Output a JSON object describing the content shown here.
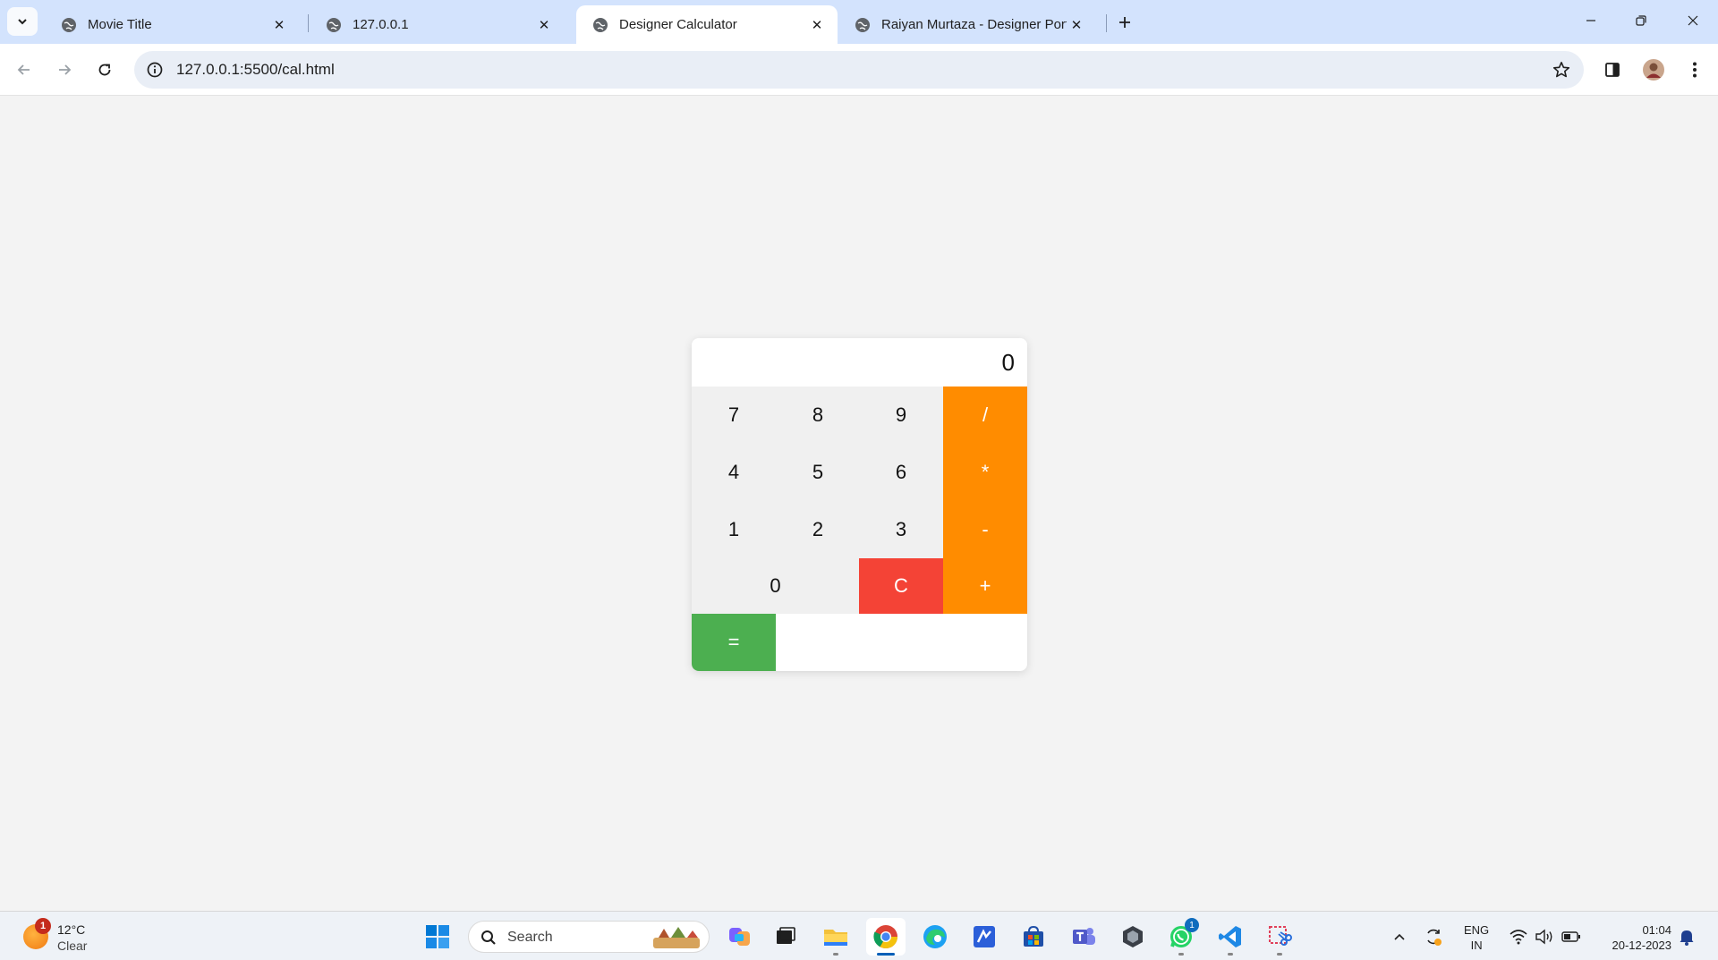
{
  "browser": {
    "tabs": [
      {
        "title": "Movie Title",
        "active": false
      },
      {
        "title": "127.0.0.1",
        "active": false
      },
      {
        "title": "Designer Calculator",
        "active": true
      },
      {
        "title": "Raiyan Murtaza - Designer Portfolio",
        "active": false
      }
    ],
    "url": "127.0.0.1:5500/cal.html"
  },
  "calculator": {
    "display": "0",
    "keys": {
      "seven": "7",
      "eight": "8",
      "nine": "9",
      "divide": "/",
      "four": "4",
      "five": "5",
      "six": "6",
      "multiply": "*",
      "one": "1",
      "two": "2",
      "three": "3",
      "subtract": "-",
      "zero": "0",
      "clear": "C",
      "add": "+",
      "equals": "="
    },
    "colors": {
      "operator": "#ff8c00",
      "clear": "#f44336",
      "equals": "#4caf50",
      "digit": "#f0f0f0"
    }
  },
  "taskbar": {
    "weather": {
      "temp": "12°C",
      "condition": "Clear",
      "badge": "1"
    },
    "search_label": "Search",
    "apps": [
      {
        "icon": "copilot-icon"
      },
      {
        "icon": "task-view-icon"
      },
      {
        "icon": "file-explorer-icon"
      },
      {
        "icon": "chrome-icon",
        "active": true
      },
      {
        "icon": "edge-icon"
      },
      {
        "icon": "vscode-insiders-icon"
      },
      {
        "icon": "microsoft-store-icon"
      },
      {
        "icon": "teams-icon"
      },
      {
        "icon": "unity-icon"
      },
      {
        "icon": "whatsapp-icon",
        "badge": "1"
      },
      {
        "icon": "vscode-icon"
      },
      {
        "icon": "snipping-tool-icon"
      }
    ],
    "language": {
      "line1": "ENG",
      "line2": "IN"
    },
    "clock": {
      "time": "01:04",
      "date": "20-12-2023"
    }
  }
}
